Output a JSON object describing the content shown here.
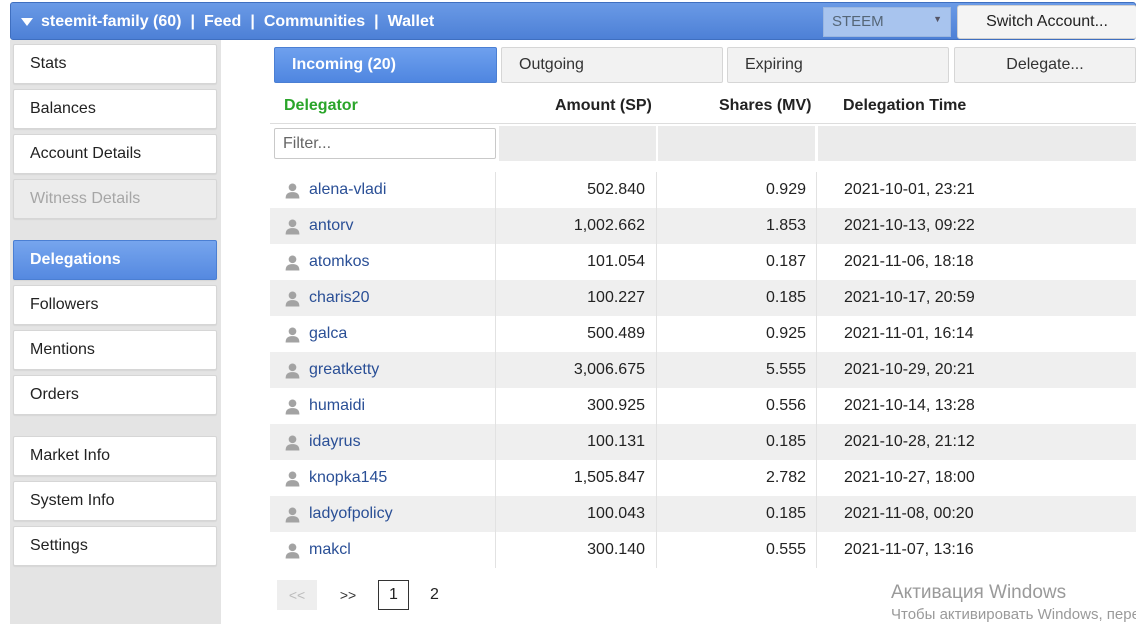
{
  "topbar": {
    "account": "steemit-family (60)",
    "nav": [
      "Feed",
      "Communities",
      "Wallet"
    ],
    "currency_select": "STEEM",
    "switch_account": "Switch Account..."
  },
  "sidebar": {
    "items": [
      {
        "label": "Stats"
      },
      {
        "label": "Balances"
      },
      {
        "label": "Account Details"
      },
      {
        "label": "Witness Details"
      },
      {
        "label": "Delegations"
      },
      {
        "label": "Followers"
      },
      {
        "label": "Mentions"
      },
      {
        "label": "Orders"
      },
      {
        "label": "Market Info"
      },
      {
        "label": "System Info"
      },
      {
        "label": "Settings"
      }
    ]
  },
  "tabs": [
    {
      "label": "Incoming (20)"
    },
    {
      "label": "Outgoing"
    },
    {
      "label": "Expiring"
    },
    {
      "label": "Delegate..."
    }
  ],
  "table": {
    "columns": [
      "Delegator",
      "Amount (SP)",
      "Shares (MV)",
      "Delegation Time"
    ],
    "filter_placeholder": "Filter...",
    "rows": [
      {
        "delegator": "alena-vladi",
        "amount": "502.840",
        "shares": "0.929",
        "time": "2021-10-01, 23:21"
      },
      {
        "delegator": "antorv",
        "amount": "1,002.662",
        "shares": "1.853",
        "time": "2021-10-13, 09:22"
      },
      {
        "delegator": "atomkos",
        "amount": "101.054",
        "shares": "0.187",
        "time": "2021-11-06, 18:18"
      },
      {
        "delegator": "charis20",
        "amount": "100.227",
        "shares": "0.185",
        "time": "2021-10-17, 20:59"
      },
      {
        "delegator": "galca",
        "amount": "500.489",
        "shares": "0.925",
        "time": "2021-11-01, 16:14"
      },
      {
        "delegator": "greatketty",
        "amount": "3,006.675",
        "shares": "5.555",
        "time": "2021-10-29, 20:21"
      },
      {
        "delegator": "humaidi",
        "amount": "300.925",
        "shares": "0.556",
        "time": "2021-10-14, 13:28"
      },
      {
        "delegator": "idayrus",
        "amount": "100.131",
        "shares": "0.185",
        "time": "2021-10-28, 21:12"
      },
      {
        "delegator": "knopka145",
        "amount": "1,505.847",
        "shares": "2.782",
        "time": "2021-10-27, 18:00"
      },
      {
        "delegator": "ladyofpolicy",
        "amount": "100.043",
        "shares": "0.185",
        "time": "2021-11-08, 00:20"
      },
      {
        "delegator": "makcl",
        "amount": "300.140",
        "shares": "0.555",
        "time": "2021-11-07, 13:16"
      }
    ]
  },
  "pagination": {
    "prev": "<<",
    "next": ">>",
    "pages": [
      "1",
      "2"
    ]
  },
  "watermark": {
    "line1": "Активация Windows",
    "line2": "Чтобы активировать Windows, пере"
  },
  "icons": {
    "dropdown": "triangle-down-icon",
    "user": "user-icon",
    "select_caret": "caret-down-icon"
  },
  "colors": {
    "accent": "#5589e0",
    "delegator_header": "#2aa52a",
    "link": "#2a4f96"
  }
}
